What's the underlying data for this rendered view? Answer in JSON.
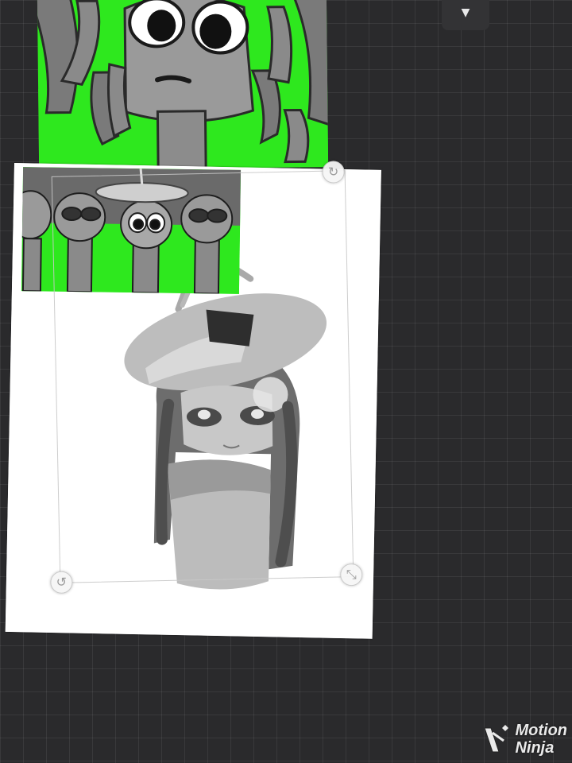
{
  "app": {
    "name": "Motion Ninja"
  },
  "toolbar": {
    "dropdown_icon": "chevron-down-icon"
  },
  "layers": [
    {
      "name": "character-closeup",
      "kind": "image",
      "palette": [
        "#2ee81e",
        "#8d8d8d",
        "#1a1a1a"
      ]
    },
    {
      "name": "character-group",
      "kind": "image",
      "palette": [
        "#2ee81e",
        "#7d7d7d",
        "#1a1a1a"
      ]
    },
    {
      "name": "hat-girl-drawing",
      "kind": "image",
      "palette": [
        "#ffffff",
        "#9a9a9a",
        "#3a3a3a"
      ]
    }
  ],
  "selection": {
    "handles": [
      "rotate-handle-icon",
      "rotate-handle-icon",
      "resize-handle-icon"
    ]
  },
  "watermark": {
    "line1": "Motion",
    "line2": "Ninja",
    "icon": "motion-ninja-logo-icon"
  },
  "colors": {
    "background": "#2a2a2c",
    "grid": "#3a3a3c",
    "green_screen": "#2ee81e"
  }
}
